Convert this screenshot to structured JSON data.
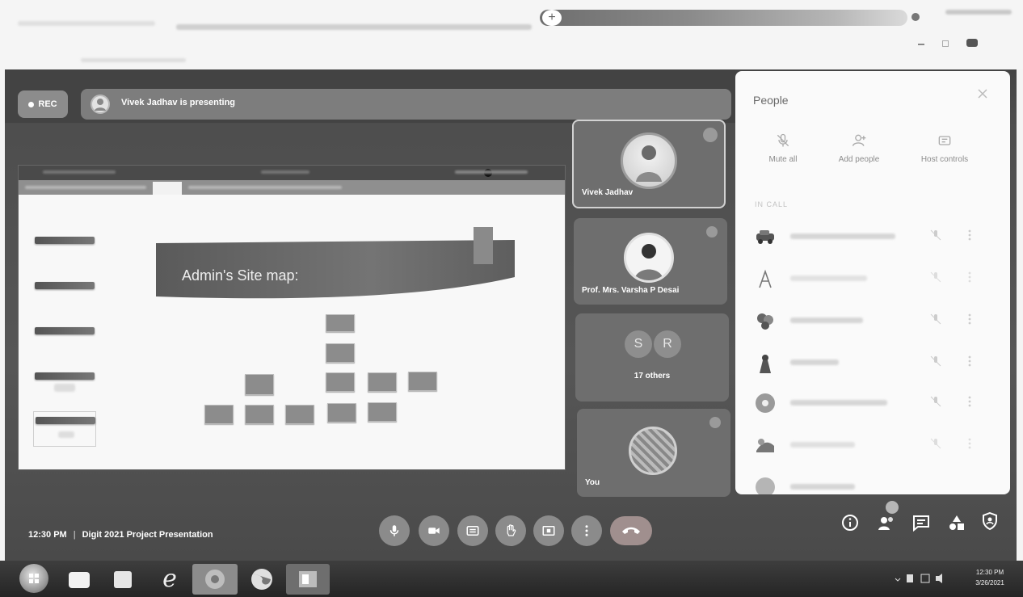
{
  "browser": {
    "new_tab_label": "+",
    "icons": [
      "new-tab-icon",
      "profile-icon",
      "minimize-icon",
      "maximize-icon",
      "extension-icon"
    ]
  },
  "meet": {
    "rec_label": "REC",
    "presenter_text": "Vivek Jadhav is presenting",
    "presentation": {
      "slide_title": "Admin's Site map:"
    },
    "tiles": [
      {
        "name": "Vivek Jadhav",
        "avatar_icon": "person-photo-avatar"
      },
      {
        "name": "Prof. Mrs. Varsha P Desai",
        "avatar_icon": "person-photo-avatar"
      },
      {
        "initials": [
          "S",
          "R"
        ],
        "label": "17 others"
      },
      {
        "name": "You",
        "avatar_icon": "photo-avatar"
      }
    ],
    "people_panel": {
      "title": "People",
      "actions": [
        {
          "label": "Mute all",
          "icon": "mic-off-icon"
        },
        {
          "label": "Add people",
          "icon": "add-person-icon"
        },
        {
          "label": "Host controls",
          "icon": "host-controls-icon"
        }
      ],
      "section_label": "IN CALL",
      "participants": [
        {
          "avatar_icon": "car-avatar"
        },
        {
          "avatar_icon": "sketch-avatar"
        },
        {
          "avatar_icon": "group-photo-avatar"
        },
        {
          "avatar_icon": "person-photo-avatar"
        },
        {
          "avatar_icon": "letter-avatar"
        },
        {
          "avatar_icon": "photo-avatar"
        },
        {
          "avatar_icon": "letter-avatar"
        }
      ]
    },
    "footer": {
      "time": "12:30 PM",
      "separator": "|",
      "meeting_title": "Digit 2021 Project Presentation"
    },
    "controls": [
      "mic-icon",
      "camera-icon",
      "captions-icon",
      "raise-hand-icon",
      "present-icon",
      "more-options-icon",
      "end-call-icon"
    ],
    "side_controls": [
      "meeting-details-icon",
      "people-icon",
      "chat-icon",
      "activities-icon",
      "host-controls-icon"
    ],
    "colors": {
      "meet_background": "#505050",
      "tile_background": "#6e6e6e",
      "panel_background": "#fafafa",
      "end_call": "#a08f8e"
    }
  },
  "taskbar": {
    "ie_glyph": "e",
    "clock_time": "12:30 PM",
    "clock_date": "3/26/2021"
  }
}
